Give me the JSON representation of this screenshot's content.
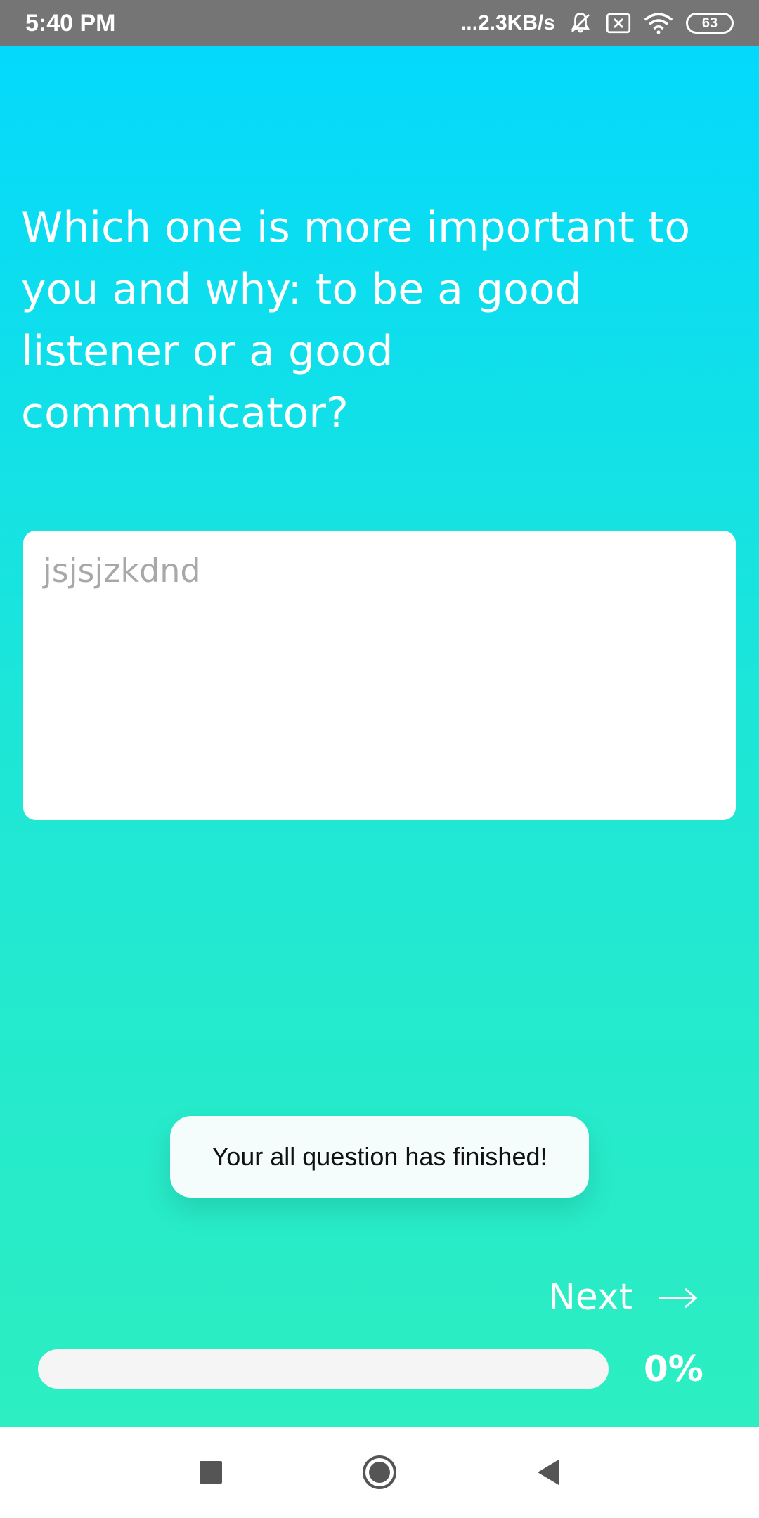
{
  "status_bar": {
    "time": "5:40 PM",
    "network_speed": "...2.3KB/s",
    "battery_level": "63"
  },
  "question": {
    "text": "Which one is more important to you and why: to be a good listener or a good communicator?"
  },
  "answer": {
    "value": "jsjsjzkdnd"
  },
  "toast": {
    "message": "Your all question has finished!"
  },
  "navigation": {
    "next_label": "Next"
  },
  "progress": {
    "percent": 0,
    "label": "0%"
  },
  "colors": {
    "gradient_top": "#03d9fc",
    "gradient_bottom": "#2ceec1",
    "status_bar": "#757575"
  }
}
